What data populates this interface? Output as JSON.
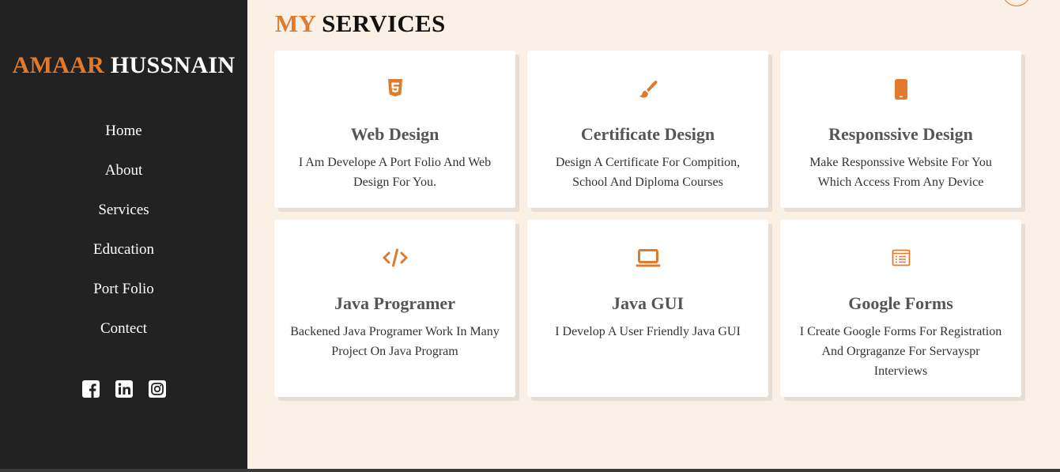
{
  "brand": {
    "first": "AMAAR",
    "last": "HUSSNAIN"
  },
  "nav": [
    "Home",
    "About",
    "Services",
    "Education",
    "Port Folio",
    "Contect"
  ],
  "socials": [
    "facebook-icon",
    "linkedin-icon",
    "instagram-icon"
  ],
  "section": {
    "title_accent": "MY",
    "title_rest": "SERVICES"
  },
  "services": [
    {
      "icon": "html5-icon",
      "title": "Web Design",
      "desc": "I Am Develope A Port Folio And Web Design For You."
    },
    {
      "icon": "paint-brush-icon",
      "title": "Certificate Design",
      "desc": "Design A Certificate For Compition, School And Diploma Courses"
    },
    {
      "icon": "mobile-icon",
      "title": "Responssive Design",
      "desc": "Make Responssive Website For You Which Access From Any Device"
    },
    {
      "icon": "code-icon",
      "title": "Java Programer",
      "desc": "Backened Java Programer Work In Many Project On Java Program"
    },
    {
      "icon": "laptop-icon",
      "title": "Java GUI",
      "desc": "I Develop A User Friendly Java GUI"
    },
    {
      "icon": "form-icon",
      "title": "Google Forms",
      "desc": "I Create Google Forms For Registration And Orgraganze For Servayspr Interviews"
    }
  ],
  "colors": {
    "accent": "#e07b2d",
    "sidebar": "#222222",
    "background": "#fbf0e6"
  }
}
